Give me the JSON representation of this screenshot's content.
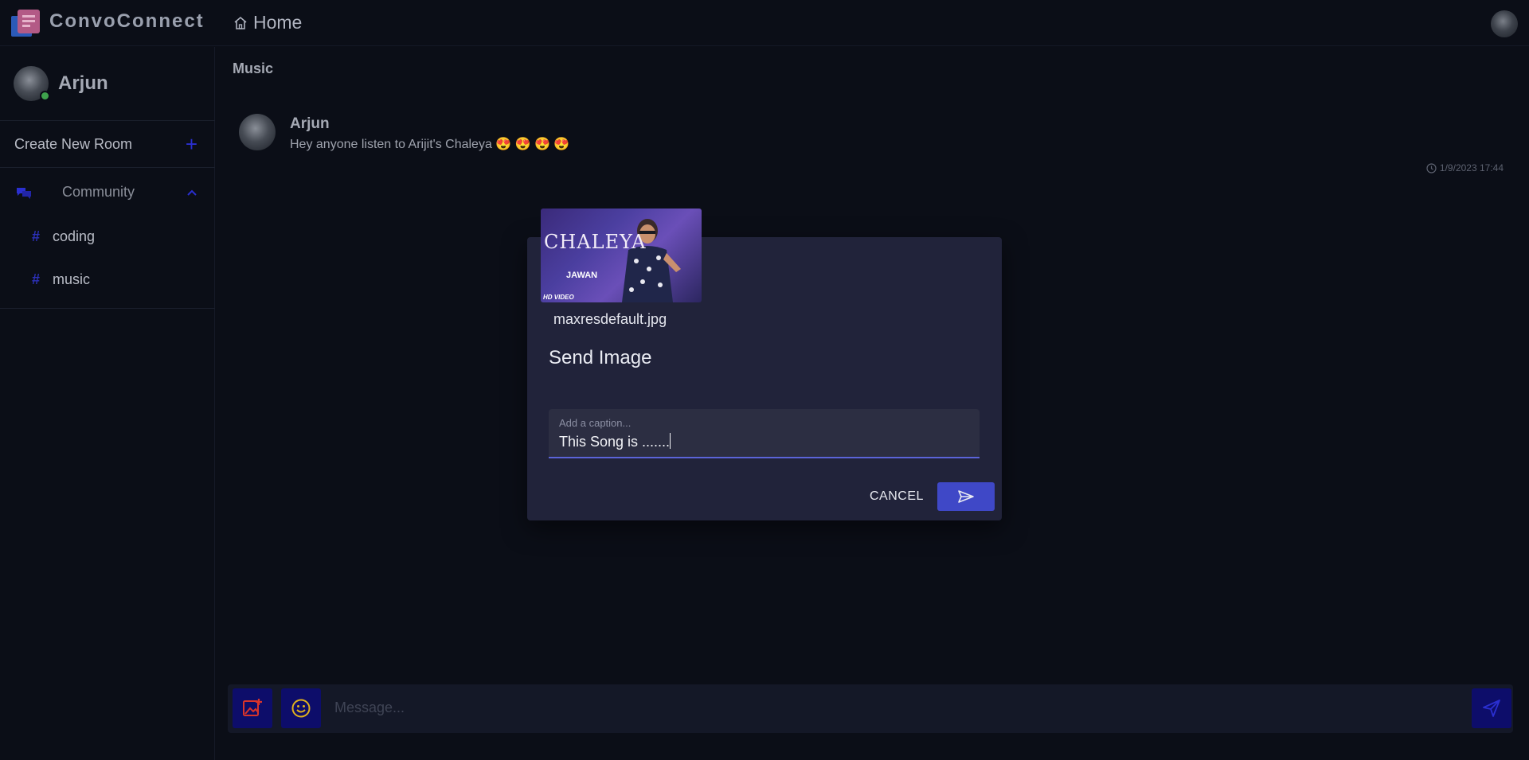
{
  "app": {
    "title": "ConvoConnect"
  },
  "header": {
    "home_label": "Home"
  },
  "sidebar": {
    "user_name": "Arjun",
    "create_room_label": "Create New Room",
    "community_label": "Community",
    "channels": [
      {
        "label": "coding"
      },
      {
        "label": "music"
      }
    ]
  },
  "main": {
    "room_title": "Music",
    "messages": [
      {
        "author": "Arjun",
        "text": "Hey anyone listen to Arijit's Chaleya 😍 😍 😍 😍",
        "timestamp": "1/9/2023 17:44"
      }
    ]
  },
  "composer": {
    "placeholder": "Message..."
  },
  "dialog": {
    "thumbnail_title": "CHALEYA",
    "thumbnail_subtitle": "JAWAN",
    "thumbnail_badge": "HD VIDEO",
    "file_name": "maxresdefault.jpg",
    "title": "Send Image",
    "caption_label": "Add a caption...",
    "caption_value": "This Song is .......",
    "cancel_label": "CANCEL"
  },
  "colors": {
    "accent": "#3f48c7",
    "icon_blue": "#2a2fd0",
    "image_icon_red": "#d9342b",
    "emoji_icon_yellow": "#e0b21d",
    "online": "#3fa34d"
  },
  "icons": [
    "logo-icon",
    "home-icon",
    "plus-icon",
    "community-icon",
    "chevron-up-icon",
    "hash-icon",
    "clock-icon",
    "add-image-icon",
    "emoji-icon",
    "send-icon"
  ]
}
